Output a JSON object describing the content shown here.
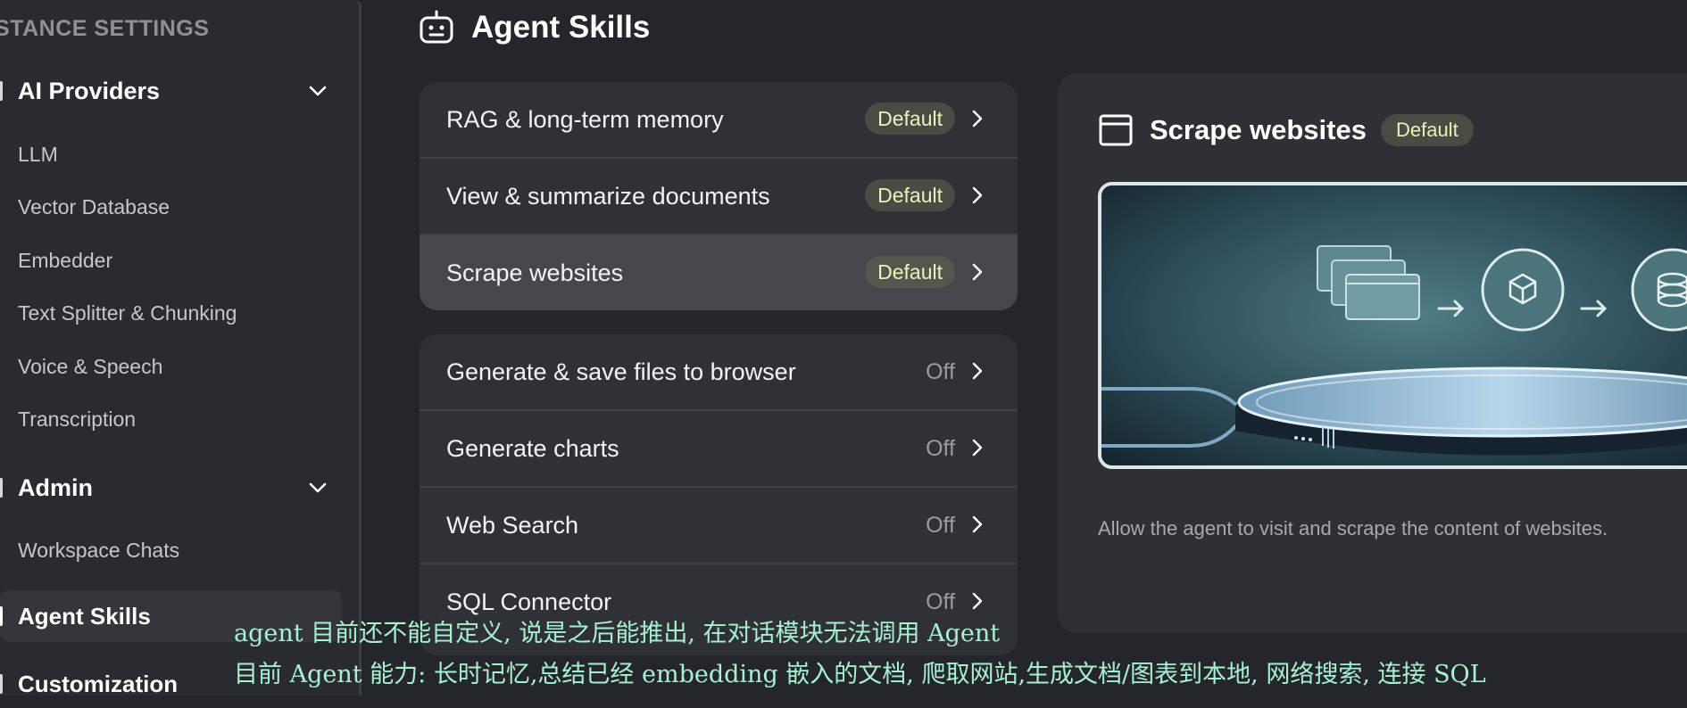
{
  "sidebar": {
    "heading": "STANCE SETTINGS",
    "groups": [
      {
        "label": "AI Providers",
        "items": [
          "LLM",
          "Vector Database",
          "Embedder",
          "Text Splitter & Chunking",
          "Voice & Speech",
          "Transcription"
        ]
      },
      {
        "label": "Admin",
        "items": [
          "Workspace Chats"
        ]
      }
    ],
    "active_item": "Agent Skills",
    "customization": "Customization"
  },
  "page": {
    "title": "Agent Skills",
    "title_icon": "robot-icon"
  },
  "skills_default": [
    {
      "name": "RAG & long-term memory",
      "status": "Default"
    },
    {
      "name": "View & summarize documents",
      "status": "Default"
    },
    {
      "name": "Scrape websites",
      "status": "Default"
    }
  ],
  "skills_optional": [
    {
      "name": "Generate & save files to browser",
      "status": "Off"
    },
    {
      "name": "Generate charts",
      "status": "Off"
    },
    {
      "name": "Web Search",
      "status": "Off"
    },
    {
      "name": "SQL Connector",
      "status": "Off"
    }
  ],
  "detail": {
    "title": "Scrape websites",
    "badge": "Default",
    "icon": "browser-window-icon",
    "description": "Allow the agent to visit and scrape the content of websites."
  },
  "subtitles": [
    "agent 目前还不能自定义, 说是之后能推出, 在对话模块无法调用 Agent",
    "目前 Agent 能力: 长时记忆,总结已经 embedding 嵌入的文档, 爬取网站,生成文档/图表到本地, 网络搜索, 连接 SQL"
  ],
  "colors": {
    "background": "#25262b",
    "badge_text": "#ecf1b8",
    "subtitle": "#a7f0d2"
  }
}
